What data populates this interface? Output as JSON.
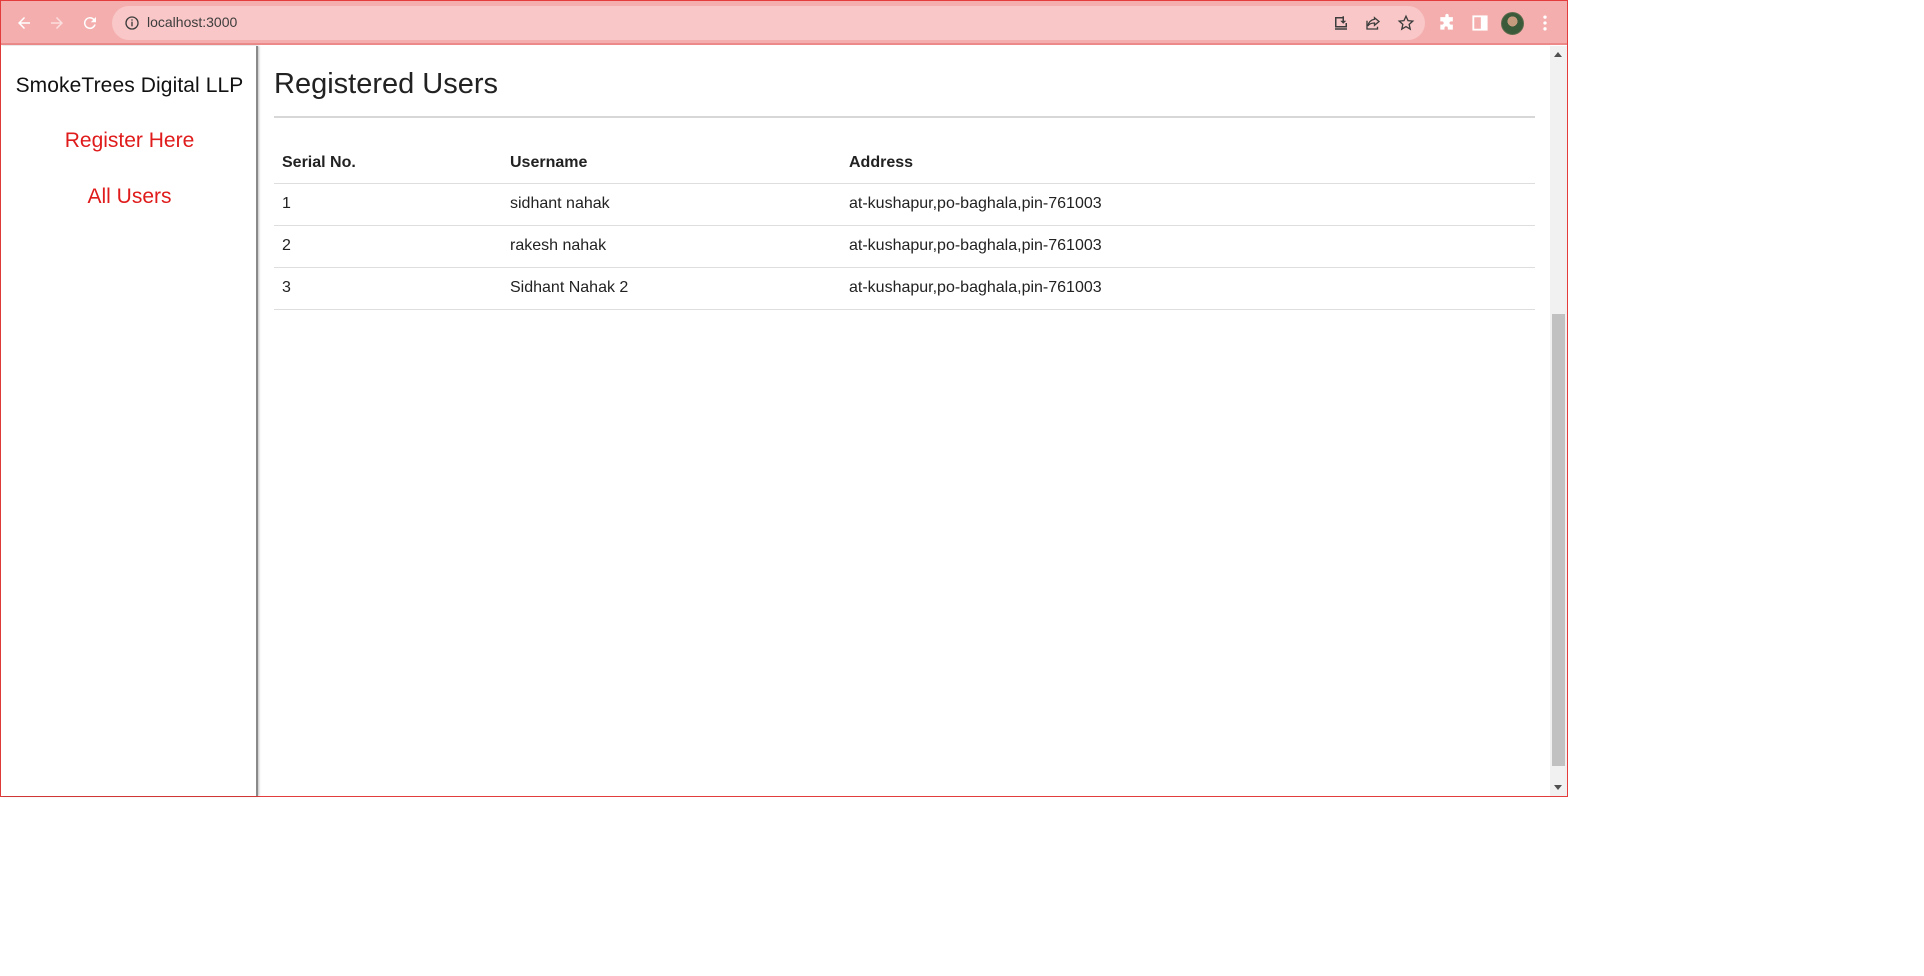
{
  "browser": {
    "url": "localhost:3000",
    "icons": [
      "back-arrow-icon",
      "forward-arrow-icon",
      "reload-icon",
      "info-icon",
      "install-icon",
      "share-icon",
      "star-icon",
      "extensions-icon",
      "side-panel-icon",
      "profile-avatar",
      "menu-dots-icon"
    ],
    "accent_color": "#f4aeae"
  },
  "sidebar": {
    "brand": "SmokeTrees Digital LLP",
    "links": [
      {
        "label": "Register Here"
      },
      {
        "label": "All Users"
      }
    ],
    "link_color": "#e01b1b"
  },
  "main": {
    "title": "Registered Users",
    "table": {
      "headers": [
        "Serial No.",
        "Username",
        "Address"
      ],
      "rows": [
        [
          "1",
          "sidhant nahak",
          "at-kushapur,po-baghala,pin-761003"
        ],
        [
          "2",
          "rakesh nahak",
          "at-kushapur,po-baghala,pin-761003"
        ],
        [
          "3",
          "Sidhant Nahak 2",
          "at-kushapur,po-baghala,pin-761003"
        ]
      ]
    }
  }
}
